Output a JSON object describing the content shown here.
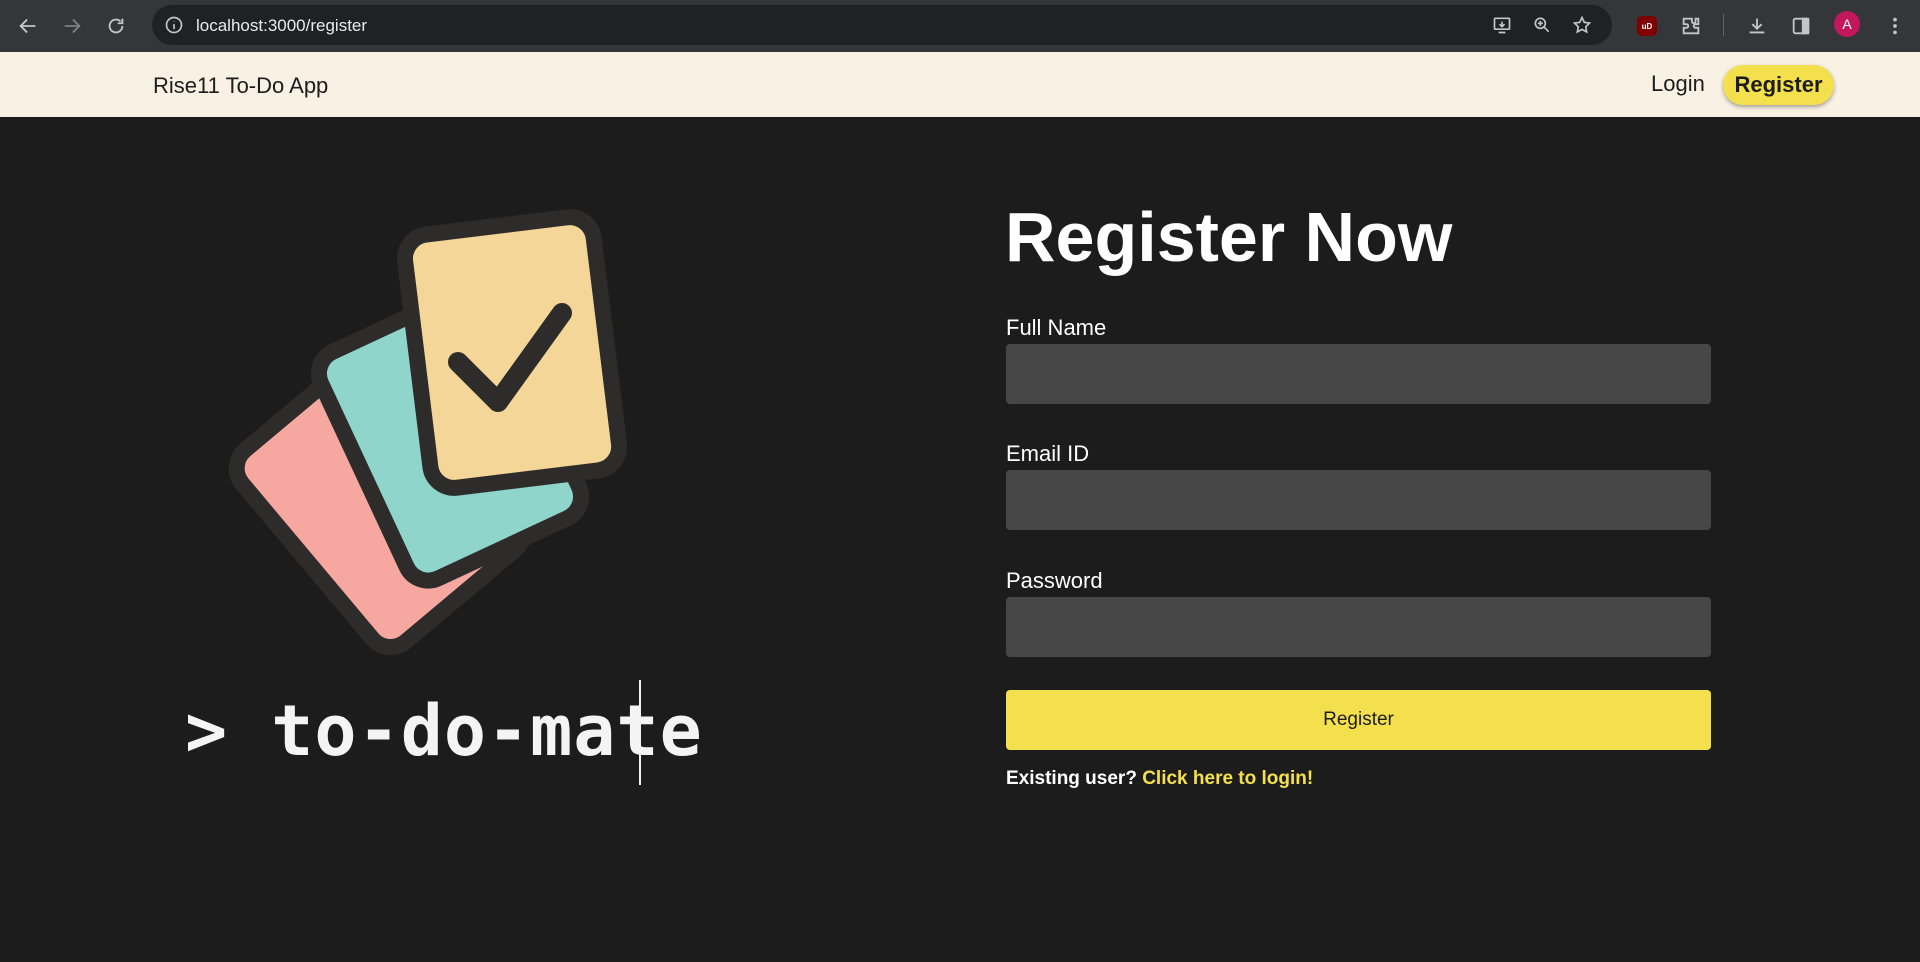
{
  "browser": {
    "url": "localhost:3000/register",
    "profile_initial": "A",
    "extension_badge": "uD",
    "icons": [
      "back-icon",
      "forward-icon",
      "reload-icon",
      "site-info-icon",
      "install-app-icon",
      "zoom-icon",
      "bookmark-star-icon",
      "ublock-icon",
      "extensions-icon",
      "downloads-icon",
      "side-panel-icon",
      "profile-avatar",
      "menu-icon"
    ]
  },
  "navbar": {
    "brand": "Rise11 To-Do App",
    "login": "Login",
    "register": "Register"
  },
  "hero": {
    "tagline": "> to-do-mate",
    "logo_colors": {
      "card_back": "#f6a8a0",
      "card_middle": "#8fd5cc",
      "card_front": "#f5d699",
      "outline": "#2e2c2a",
      "check": "#2e2c2a"
    }
  },
  "form": {
    "title": "Register Now",
    "fields": [
      {
        "label": "Full Name",
        "value": ""
      },
      {
        "label": "Email ID",
        "value": ""
      },
      {
        "label": "Password",
        "value": ""
      }
    ],
    "submit": "Register",
    "existing_prompt": "Existing user?",
    "login_link": "Click here to login!"
  },
  "colors": {
    "background": "#1c1c1c",
    "navbar": "#f9f2e4",
    "accent": "#f4e04d",
    "input": "#474747"
  }
}
